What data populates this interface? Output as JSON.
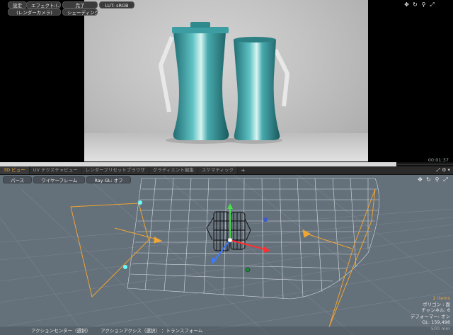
{
  "render_toolbar": {
    "settings": "設定",
    "effects": "エフェクト:(...",
    "done": "完了",
    "lut": "LUT: sRGB",
    "camera": "(レンダーカメラ)",
    "shading": "シェーディング..."
  },
  "render_view": {
    "timecode": "00:01:37",
    "progress": 0.875
  },
  "icons": {
    "move": "move-icon",
    "rotate": "rotate-icon",
    "zoom": "search-icon",
    "maximize": "maximize-icon"
  },
  "tabs": [
    {
      "label": "3D ビュー",
      "active": true
    },
    {
      "label": "UV テクスチャビュー",
      "active": false
    },
    {
      "label": "レンダープリセットブラウザ",
      "active": false
    },
    {
      "label": "グラディエント編集",
      "active": false
    },
    {
      "label": "スケマティック",
      "active": false
    }
  ],
  "tab_add": "+",
  "viewport_toolbar": {
    "perspective": "パース",
    "wireframe": "ワイヤーフレーム",
    "ray_gl": "Ray GL: オフ"
  },
  "hud": {
    "items": "2 Items",
    "polygons": "ポリゴン : 面",
    "channels": "チャンネル: 6",
    "deformers": "デフォーマー: オン",
    "gl": "GL: 159,498",
    "scale": "500 mm"
  },
  "status_bar": {
    "action_center": "アクションセンター（選択）",
    "action_axis": "アクションアクシス（選択）",
    "transform": "：トランスフォーム"
  },
  "colors": {
    "accent": "#f0a531",
    "viewport_bg": "#64707a",
    "teal": "#3e9ea3"
  }
}
